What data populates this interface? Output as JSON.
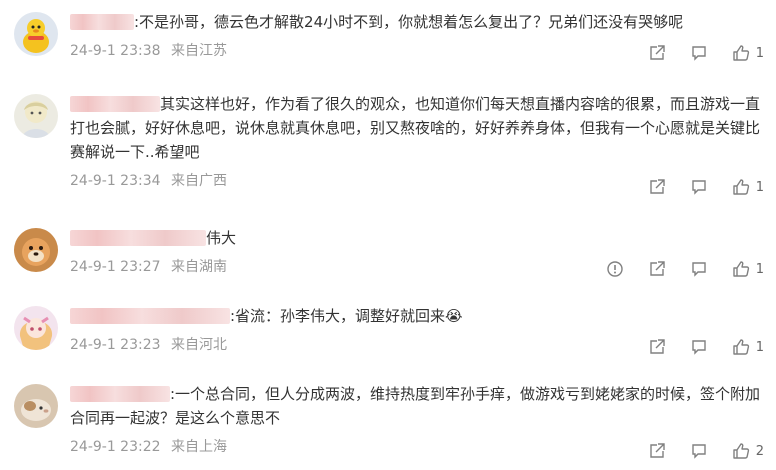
{
  "comments": [
    {
      "text": ":不是孙哥，德云色才解散24小时不到，你就想着怎么复出了？兄弟们还没有哭够呢",
      "date": "24-9-1 23:38",
      "location": "来自江苏",
      "likes": "1"
    },
    {
      "text": "其实这样也好，作为看了很久的观众，也知道你们每天想直播内容啥的很累，而且游戏一直打也会腻，好好休息吧，说休息就真休息吧，别又熬夜啥的，好好养养身体，但我有一个心愿就是关键比赛解说一下..希望吧",
      "date": "24-9-1 23:34",
      "location": "来自广西",
      "likes": "1"
    },
    {
      "text": "伟大",
      "date": "24-9-1 23:27",
      "location": "来自湖南",
      "likes": "1"
    },
    {
      "text": ":省流：孙李伟大，调整好就回来😭",
      "date": "24-9-1 23:23",
      "location": "来自河北",
      "likes": "1"
    },
    {
      "text": ":一个总合同，但人分成两波，维持热度到牢孙手痒，做游戏亏到姥姥家的时候，签个附加合同再一起波？是这么个意思不",
      "date": "24-9-1 23:22",
      "location": "来自上海",
      "likes": "2"
    }
  ],
  "icons": {
    "share": "share-icon",
    "comment": "comment-icon",
    "like": "thumbs-up-icon",
    "report": "report-icon"
  },
  "colors": {
    "text": "#333333",
    "meta": "#999999",
    "icon": "#808080",
    "mask": "#f4d2d2"
  }
}
